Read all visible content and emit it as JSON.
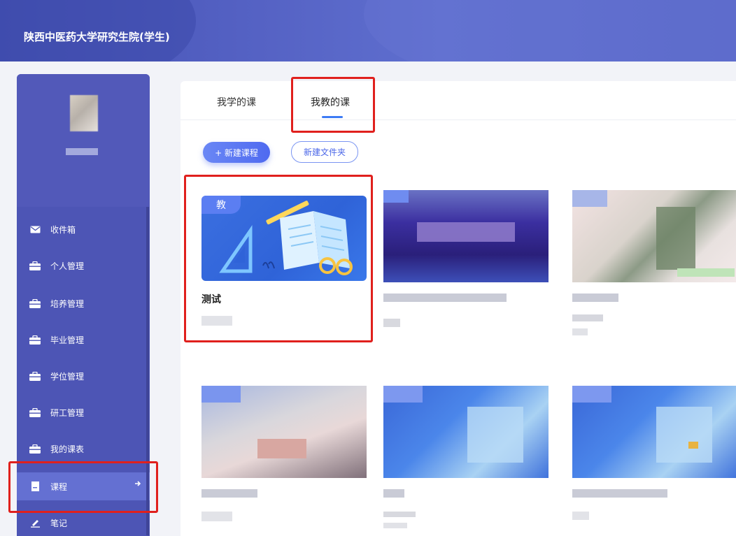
{
  "app": {
    "title": "陕西中医药大学研究生院(学生)"
  },
  "sidebar": {
    "items": [
      {
        "label": "收件箱",
        "icon": "mail-icon"
      },
      {
        "label": "个人管理",
        "icon": "briefcase-icon"
      },
      {
        "label": "培养管理",
        "icon": "briefcase-icon"
      },
      {
        "label": "毕业管理",
        "icon": "briefcase-icon"
      },
      {
        "label": "学位管理",
        "icon": "briefcase-icon"
      },
      {
        "label": "研工管理",
        "icon": "briefcase-icon"
      },
      {
        "label": "我的课表",
        "icon": "briefcase-icon"
      },
      {
        "label": "课程",
        "icon": "book-icon",
        "active": true
      },
      {
        "label": "笔记",
        "icon": "pen-icon"
      }
    ]
  },
  "tabs": [
    {
      "label": "我学的课"
    },
    {
      "label": "我教的课",
      "active": true
    }
  ],
  "actions": {
    "new_course": "+ 新建课程",
    "new_folder": "新建文件夹"
  },
  "courses": [
    {
      "badge": "教",
      "title": "测试"
    }
  ],
  "colors": {
    "header": "#4f5cc1",
    "sidebar": "#4d55b5",
    "accent": "#3d7bf5",
    "highlight": "#e0201d"
  }
}
